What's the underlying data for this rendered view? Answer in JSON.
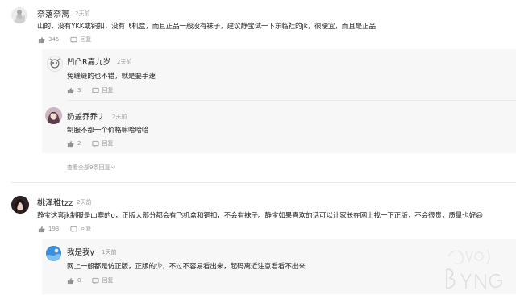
{
  "comments": [
    {
      "username": "奈落奈离",
      "time": "2天前",
      "text": "山的，没有YKK或铜扣，没有飞机盒，而且正品一般没有袜子，建议静宝试一下东临社的jk，很便宜，而且是正品",
      "likes": "345",
      "reply_label": "回复",
      "replies": [
        {
          "username": "凹凸R嘉九岁",
          "time": "2天前",
          "text": "免缝缝的也不错，就是要手速",
          "likes": "3",
          "reply_label": "回复"
        },
        {
          "username": "奶盖乔乔丿",
          "time": "2天前",
          "text": "制服不都一个价格嘛哈哈哈",
          "likes": "2",
          "reply_label": "回复"
        }
      ],
      "more_replies": "查看全部9条回复"
    },
    {
      "username": "桃泽稚tzz",
      "time": "2天前",
      "text": "静宝这套jk制服是山寨的o，正版大部分都会有飞机盒和铜扣，不会有袜子。静宝如果喜欢的话可以让家长在网上找一下正版，不会很贵，质量也好",
      "emoji": "😃",
      "likes": "193",
      "reply_label": "回复",
      "replies": [
        {
          "username": "我是我y",
          "time": "1天前",
          "text": "网上一般都是仿正版，正版的少，不过不容易看出来，起码离近注意看看不出来",
          "likes": "0",
          "reply_label": "回复"
        }
      ]
    }
  ],
  "icons": {
    "like": "thumbs-up-icon",
    "reply": "reply-icon",
    "chevron": "chevron-down-icon"
  },
  "colors": {
    "muted": "#999999",
    "reply_bg": "#f7f7f7"
  }
}
